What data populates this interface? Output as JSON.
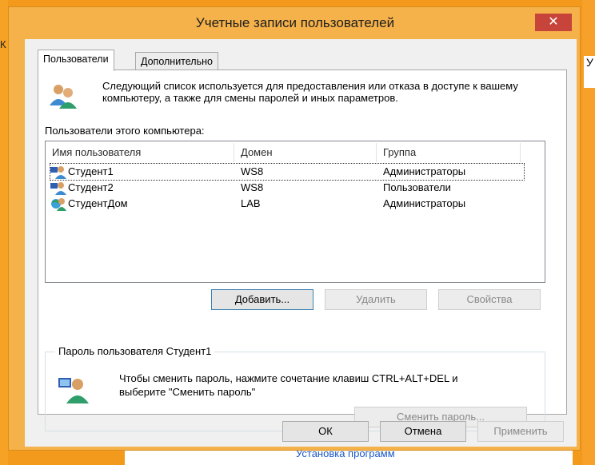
{
  "window": {
    "title": "Учетные записи пользователей",
    "close_glyph": "✕"
  },
  "tabs": [
    {
      "label": "Пользователи",
      "active": true
    },
    {
      "label": "Дополнительно",
      "active": false
    }
  ],
  "users_tab": {
    "description": "Следующий список используется для предоставления или отказа в доступе к вашему компьютеру, а также для смены паролей и иных параметров.",
    "list_label": "Пользователи этого компьютера:",
    "columns": [
      "Имя пользователя",
      "Домен",
      "Группа"
    ],
    "rows": [
      {
        "name": "Студент1",
        "domain": "WS8",
        "group": "Администраторы",
        "icon": "local-user-icon",
        "selected": true
      },
      {
        "name": "Студент2",
        "domain": "WS8",
        "group": "Пользователи",
        "icon": "local-user-icon",
        "selected": false
      },
      {
        "name": "СтудентДом",
        "domain": "LAB",
        "group": "Администраторы",
        "icon": "domain-user-icon",
        "selected": false
      }
    ],
    "buttons": {
      "add": "Добавить...",
      "remove": "Удалить",
      "properties": "Свойства"
    },
    "password_group": {
      "title": "Пароль пользователя Студент1",
      "text": "Чтобы сменить пароль, нажмите сочетание клавиш CTRL+ALT+DEL и выберите \"Сменить пароль\"",
      "change_button": "Сменить пароль..."
    }
  },
  "dialog_buttons": {
    "ok": "ОК",
    "cancel": "Отмена",
    "apply": "Применить"
  },
  "background": {
    "taskbar_text": "Установка программ",
    "peek_right": "У",
    "peek_left": "К"
  },
  "colors": {
    "desktop": "#f39a1d",
    "frame": "#f5b14a",
    "close": "#c7443a"
  }
}
